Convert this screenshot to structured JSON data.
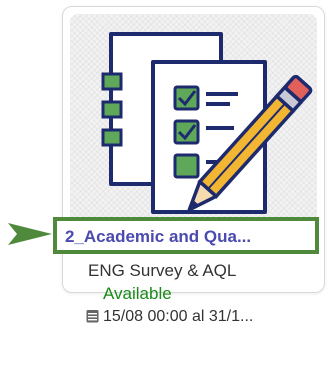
{
  "activity": {
    "title": "2_Academic and Qua...",
    "subtitle": "ENG Survey & AQL",
    "status": "Available",
    "dates": "15/08 00:00 al 31/1...",
    "thumbnail_icon": "checklist-pencil-icon",
    "date_icon": "calendar-icon"
  },
  "colors": {
    "title": "#4a4ab0",
    "status": "#1a8a1a",
    "highlight_border": "#4f8a3c",
    "arrow": "#4f8a3c"
  }
}
